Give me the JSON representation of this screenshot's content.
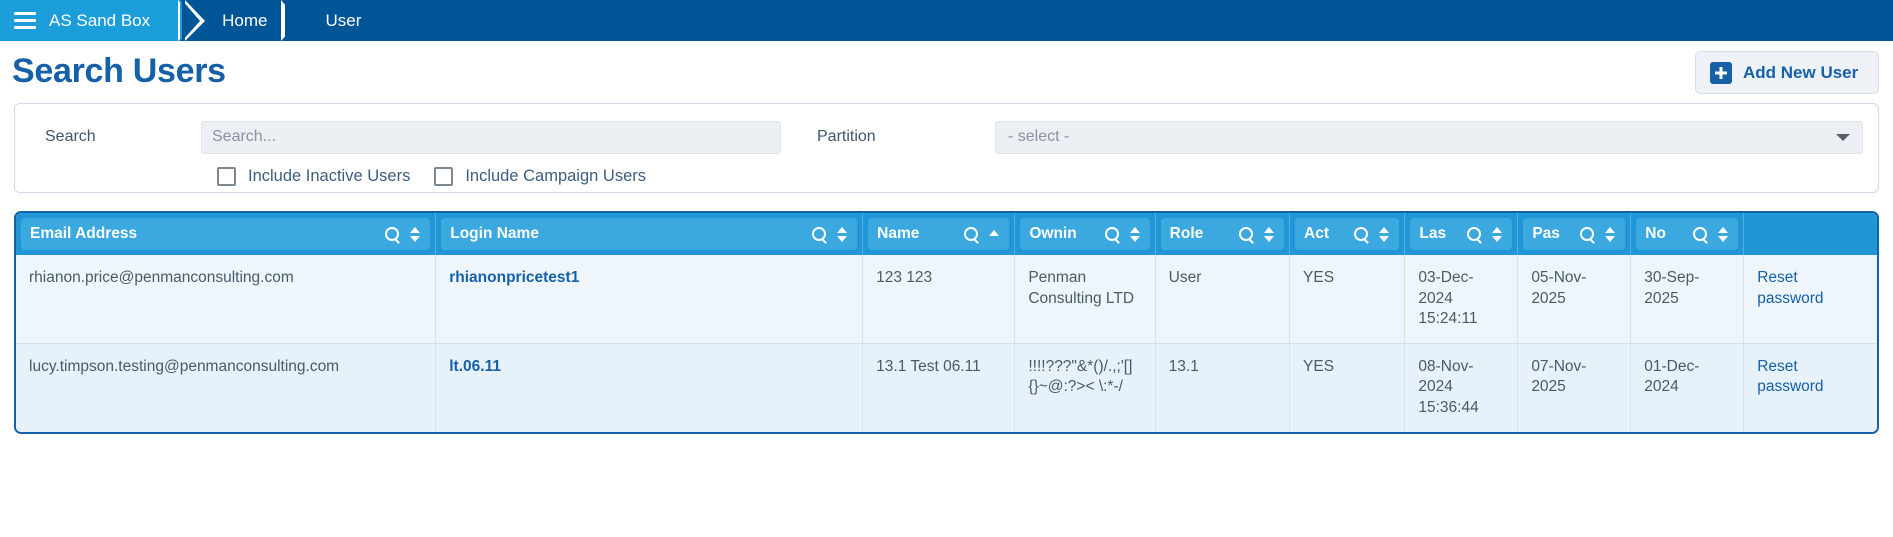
{
  "topbar": {
    "menu_icon": "hamburger-icon",
    "app_name": "AS Sand Box",
    "crumbs": [
      "Home",
      "User"
    ]
  },
  "header": {
    "title": "Search Users",
    "add_button_label": "Add New User",
    "add_button_icon": "plus-icon"
  },
  "filters": {
    "search_label": "Search",
    "search_value": "",
    "search_placeholder": "Search...",
    "partition_label": "Partition",
    "partition_selected": "- select -",
    "checkbox_inactive": "Include Inactive Users",
    "checkbox_campaign": "Include Campaign Users",
    "inactive_checked": false,
    "campaign_checked": false
  },
  "table": {
    "columns": [
      {
        "label": "Email Address",
        "sort": "none",
        "searchable": true
      },
      {
        "label": "Login Name",
        "sort": "none",
        "searchable": true
      },
      {
        "label": "Name",
        "sort": "asc",
        "searchable": true
      },
      {
        "label": "Ownin",
        "sort": "none",
        "searchable": true
      },
      {
        "label": "Role",
        "sort": "none",
        "searchable": true
      },
      {
        "label": "Act",
        "sort": "none",
        "searchable": true
      },
      {
        "label": "Las",
        "sort": "none",
        "searchable": true
      },
      {
        "label": "Pas",
        "sort": "none",
        "searchable": true
      },
      {
        "label": "No",
        "sort": "none",
        "searchable": true
      },
      {
        "label": "",
        "sort": "none",
        "searchable": false
      }
    ],
    "rows": [
      {
        "email": "rhianon.price@penmanconsulting.com",
        "login": "rhianonpricetest1",
        "name": "123 123",
        "owning": "Penman Consulting LTD",
        "role": "User",
        "active": "YES",
        "last": "03-Dec-2024 15:24:11",
        "password": "05-Nov-2025",
        "notify": "30-Sep-2025",
        "action": "Reset password"
      },
      {
        "email": "lucy.timpson.testing@penmanconsulting.com",
        "login": "lt.06.11",
        "name": "13.1 Test 06.11",
        "owning": "!!!!???\"&*()/.,;'[]{}~@:?>< \\:*-/",
        "role": "13.1",
        "active": "YES",
        "last": "08-Nov-2024 15:36:44",
        "password": "07-Nov-2025",
        "notify": "01-Dec-2024",
        "action": "Reset password"
      }
    ]
  },
  "colors": {
    "nav_dark": "#005596",
    "nav_light": "#1b9dd9",
    "brand_blue": "#1560a8",
    "table_header": "#2196d6"
  }
}
